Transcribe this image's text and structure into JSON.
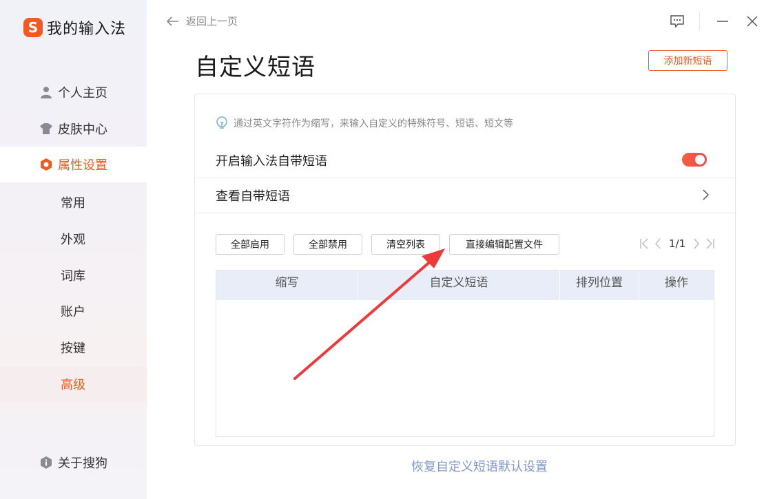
{
  "app": {
    "name": "我的输入法",
    "logo_letter": "S"
  },
  "sidebar": {
    "items": [
      {
        "label": "个人主页",
        "icon": "user-icon"
      },
      {
        "label": "皮肤中心",
        "icon": "tshirt-icon"
      },
      {
        "label": "属性设置",
        "icon": "hexagon-settings-icon"
      }
    ],
    "subitems": [
      {
        "label": "常用"
      },
      {
        "label": "外观"
      },
      {
        "label": "词库"
      },
      {
        "label": "账户"
      },
      {
        "label": "按键"
      },
      {
        "label": "高级"
      }
    ],
    "about": {
      "label": "关于搜狗",
      "icon": "info-icon"
    }
  },
  "topbar": {
    "back_label": "返回上一页"
  },
  "page": {
    "title": "自定义短语",
    "add_button": "添加新短语",
    "hint": "通过英文字符作为缩写，来输入自定义的特殊符号、短语、短文等",
    "enable_builtin": {
      "label": "开启输入法自带短语",
      "enabled": true
    },
    "view_builtin": {
      "label": "查看自带短语"
    },
    "toolbar": {
      "enable_all": "全部启用",
      "disable_all": "全部禁用",
      "clear_list": "清空列表",
      "edit_config": "直接编辑配置文件"
    },
    "pager": {
      "text": "1/1"
    },
    "table": {
      "columns": [
        "缩写",
        "自定义短语",
        "排列位置",
        "操作"
      ],
      "rows": []
    },
    "restore_link": "恢复自定义短语默认设置"
  },
  "colors": {
    "accent": "#f05a1f",
    "link": "#7f98c7",
    "table_header": "#e8edf7",
    "annotation_arrow": "#ee3a3a"
  }
}
